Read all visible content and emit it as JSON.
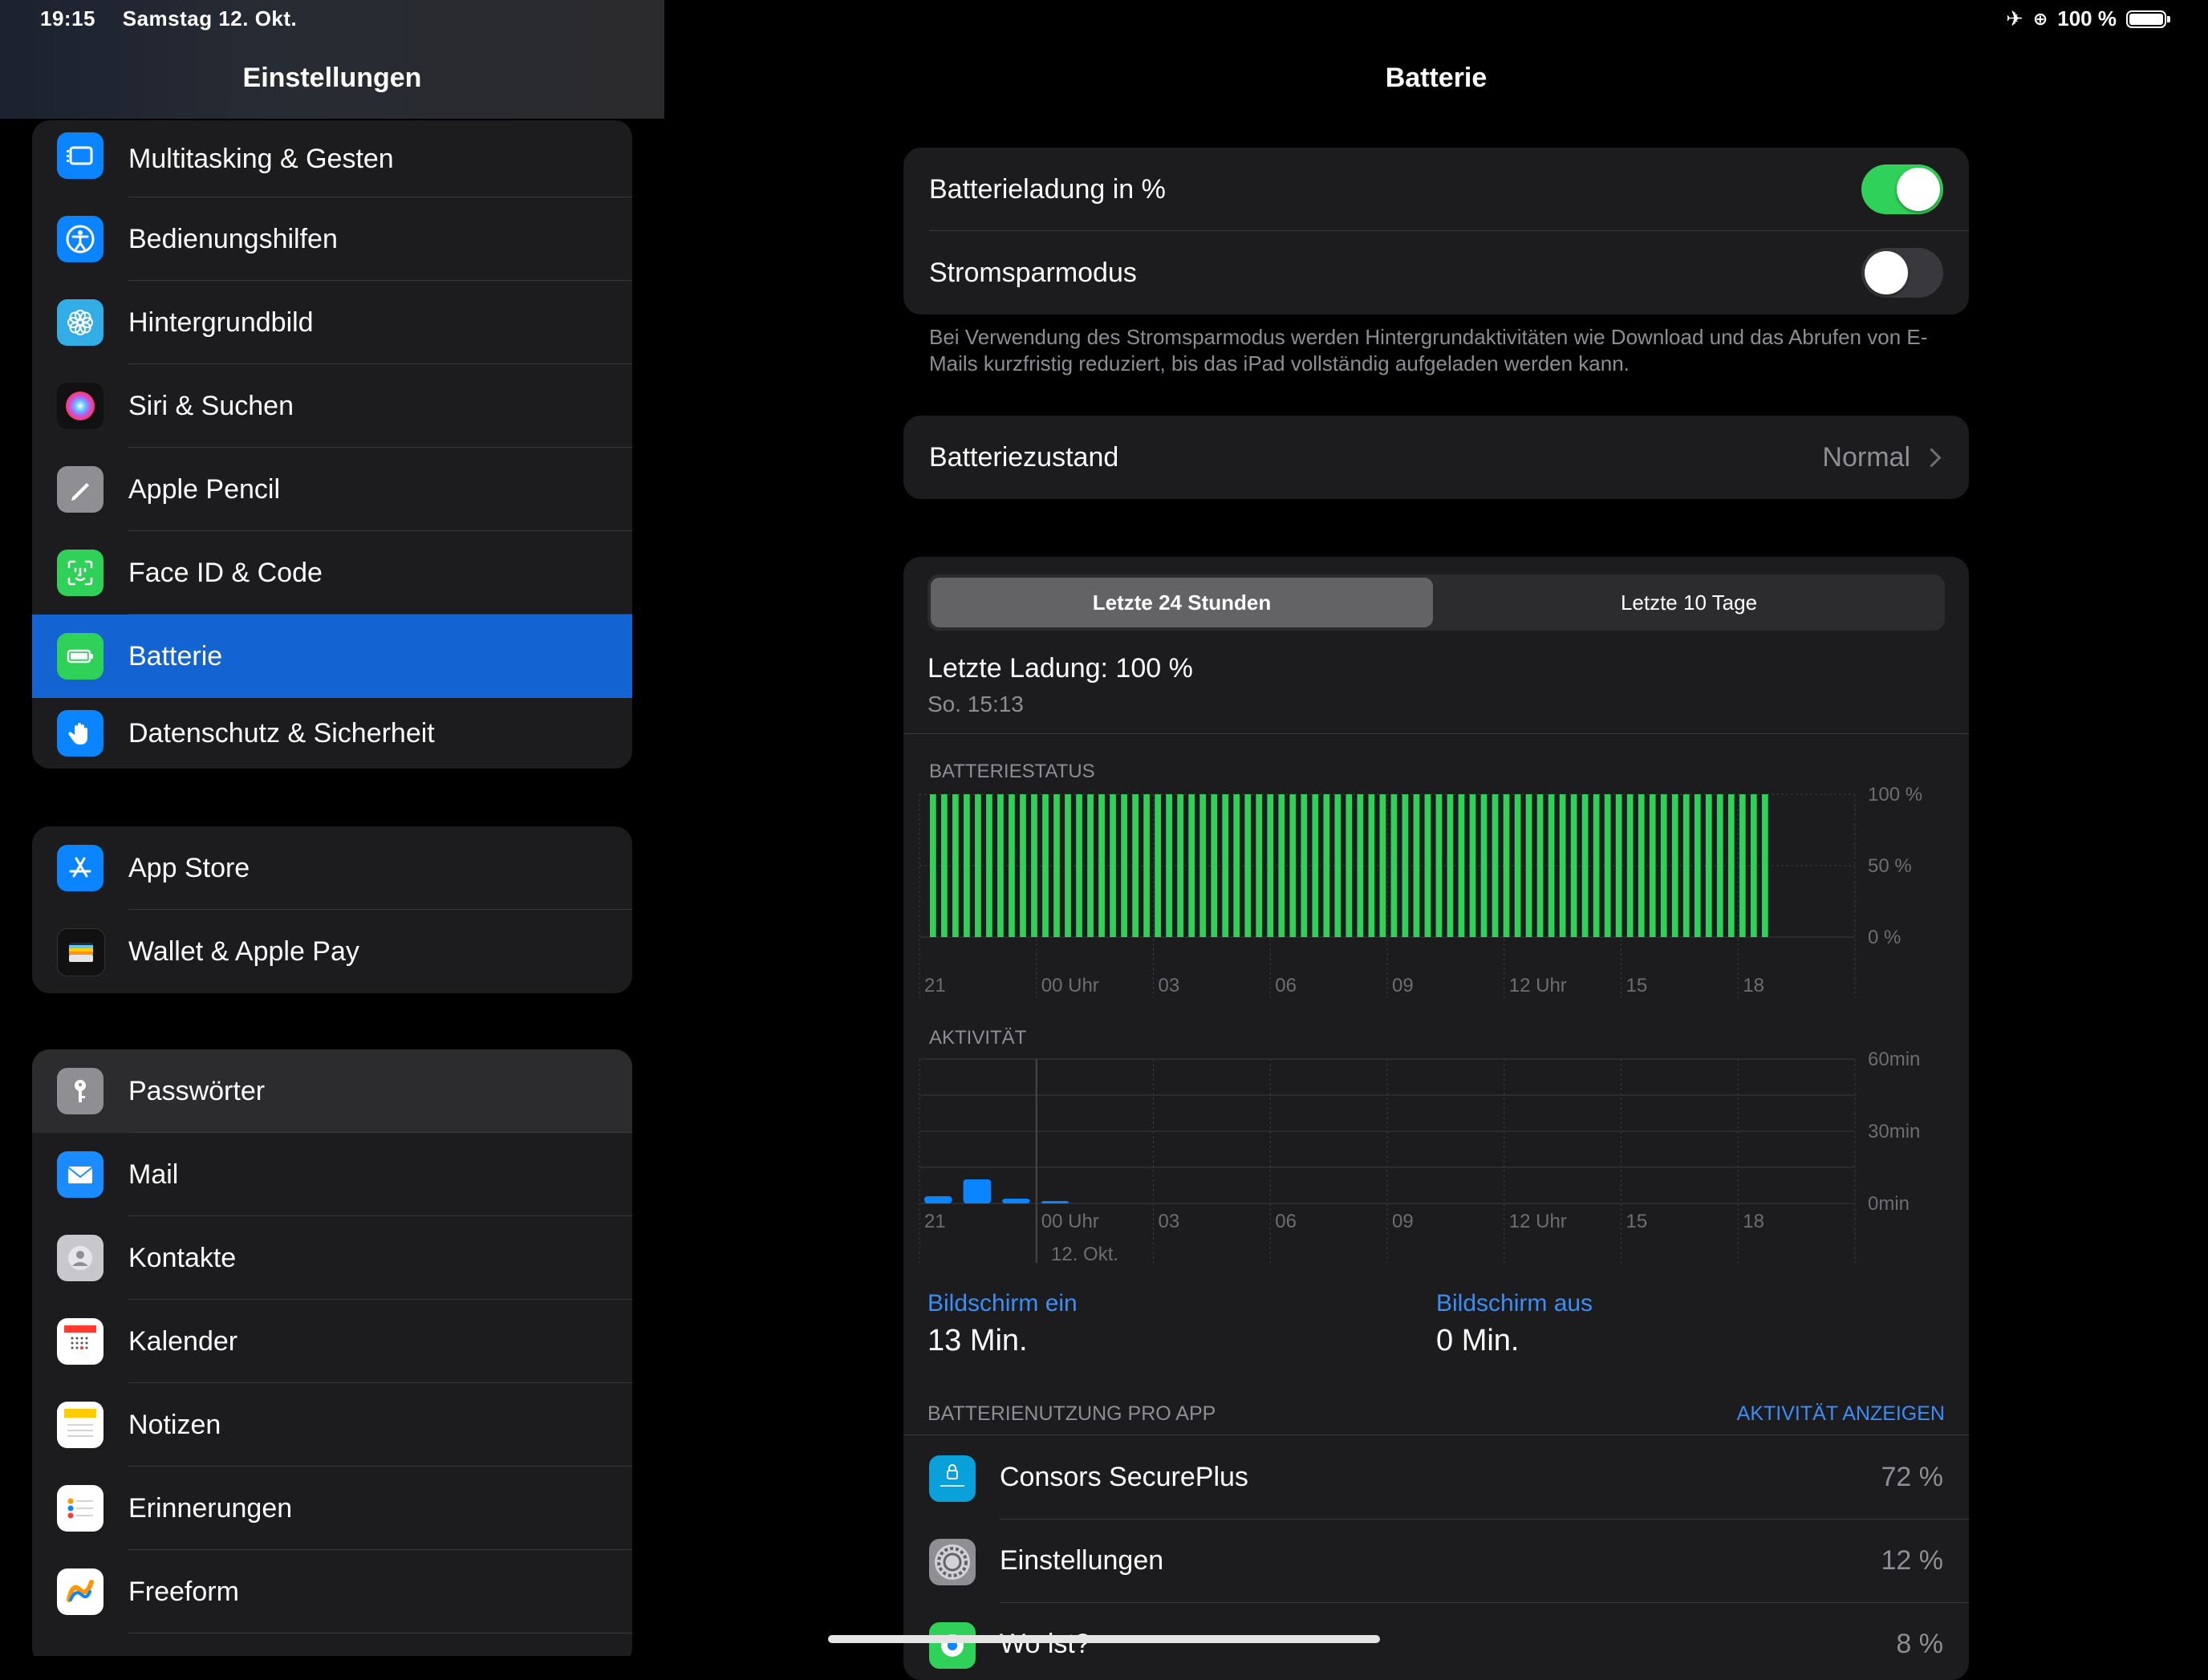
{
  "status_bar": {
    "time": "19:15",
    "date": "Samstag 12. Okt.",
    "battery_text": "100 %"
  },
  "sidebar": {
    "title": "Einstellungen",
    "group1": [
      {
        "label": "Multitasking & Gesten",
        "icon": "multitasking-icon",
        "color": "#0a84ff"
      },
      {
        "label": "Bedienungshilfen",
        "icon": "accessibility-icon",
        "color": "#0a84ff"
      },
      {
        "label": "Hintergrundbild",
        "icon": "flower-icon",
        "color": "#32ade6"
      },
      {
        "label": "Siri & Suchen",
        "icon": "siri-icon",
        "color": "#1c1c1e"
      },
      {
        "label": "Apple Pencil",
        "icon": "pencil-icon",
        "color": "#8e8e93"
      },
      {
        "label": "Face ID & Code",
        "icon": "face-id-icon",
        "color": "#30d158"
      },
      {
        "label": "Batterie",
        "icon": "battery-icon",
        "color": "#30d158"
      },
      {
        "label": "Datenschutz & Sicherheit",
        "icon": "hand-icon",
        "color": "#0a84ff"
      }
    ],
    "group2": [
      {
        "label": "App Store",
        "icon": "app-store-icon",
        "color": "#0a84ff"
      },
      {
        "label": "Wallet & Apple Pay",
        "icon": "wallet-icon",
        "color": "#1c1c1e"
      }
    ],
    "group3": [
      {
        "label": "Passwörter",
        "icon": "key-icon",
        "color": "#8e8e93"
      },
      {
        "label": "Mail",
        "icon": "mail-icon",
        "color": "#0a84ff"
      },
      {
        "label": "Kontakte",
        "icon": "contacts-icon",
        "color": "#c7c7cc"
      },
      {
        "label": "Kalender",
        "icon": "calendar-icon",
        "color": "#ffffff"
      },
      {
        "label": "Notizen",
        "icon": "notes-icon",
        "color": "#ffffff"
      },
      {
        "label": "Erinnerungen",
        "icon": "reminders-icon",
        "color": "#ffffff"
      },
      {
        "label": "Freeform",
        "icon": "freeform-icon",
        "color": "#ffffff"
      }
    ],
    "selected": "Batterie"
  },
  "main": {
    "title": "Batterie",
    "battery_percent_label": "Batterieladung in %",
    "battery_percent_on": true,
    "low_power_label": "Stromsparmodus",
    "low_power_on": false,
    "low_power_footnote": "Bei Verwendung des Stromsparmodus werden Hintergrundaktivitäten wie Download und das Abrufen von E-Mails kurzfristig reduziert, bis das iPad vollständig aufgeladen werden kann.",
    "health_label": "Batteriezustand",
    "health_value": "Normal",
    "segments": [
      "Letzte 24 Stunden",
      "Letzte 10 Tage"
    ],
    "active_segment": "Letzte 24 Stunden",
    "last_charge": "Letzte Ladung: 100 %",
    "last_charge_time": "So. 15:13",
    "battery_status_title": "BATTERIESTATUS",
    "activity_title": "AKTIVITÄT",
    "date_label": "12. Okt.",
    "screen_on_label": "Bildschirm ein",
    "screen_on_value": "13 Min.",
    "screen_off_label": "Bildschirm aus",
    "screen_off_value": "0 Min.",
    "usage_title": "BATTERIENUTZUNG PRO APP",
    "usage_action": "AKTIVITÄT ANZEIGEN",
    "apps": [
      {
        "name": "Consors SecurePlus",
        "pct": "72 %"
      },
      {
        "name": "Einstellungen",
        "pct": "12 %"
      },
      {
        "name": "Wo ist?",
        "pct": "8 %"
      }
    ],
    "accent_color": "#3a8ef6",
    "bar_color": "#30d158"
  },
  "chart_data": [
    {
      "type": "bar",
      "title": "BATTERIESTATUS",
      "x_ticks": [
        "21",
        "00 Uhr",
        "03",
        "06",
        "09",
        "12 Uhr",
        "15",
        "18"
      ],
      "y_ticks": [
        "100 %",
        "50 %",
        "0 %"
      ],
      "ylim": [
        0,
        100
      ],
      "bar_count": 75,
      "values_percent": 100
    },
    {
      "type": "bar",
      "title": "AKTIVITÄT",
      "x_ticks": [
        "21",
        "00 Uhr",
        "03",
        "06",
        "09",
        "12 Uhr",
        "15",
        "18"
      ],
      "y_ticks": [
        "60min",
        "30min",
        "0min"
      ],
      "ylim": [
        0,
        60
      ],
      "hours": [
        "21",
        "22",
        "23",
        "00"
      ],
      "values_min": [
        3,
        10,
        2,
        1
      ]
    }
  ]
}
